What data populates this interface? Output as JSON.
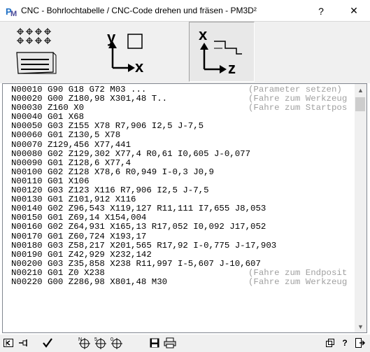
{
  "window": {
    "title": "CNC - Bohrlochtabelle / CNC-Code drehen und fräsen   -   PM3D²",
    "help_label": "?",
    "close_label": "✕"
  },
  "toolbar": {
    "xy_axis_x": "x",
    "xy_axis_y": "y",
    "xz_axis_x": "x",
    "xz_axis_z": "z"
  },
  "code_lines": [
    {
      "cmd": "N00010 G90 G18 G72 M03 ...",
      "comment": "(Parameter setzen)"
    },
    {
      "cmd": "N00020 G00 Z180,98 X301,48 T..",
      "comment": "(Fahre zum Werkzeug"
    },
    {
      "cmd": "N00030 Z160 X0",
      "comment": "(Fahre zum Startpos"
    },
    {
      "cmd": "N00040 G01 X68",
      "comment": ""
    },
    {
      "cmd": "N00050 G03 Z155 X78 R7,906 I2,5 J-7,5",
      "comment": ""
    },
    {
      "cmd": "N00060 G01 Z130,5 X78",
      "comment": ""
    },
    {
      "cmd": "N00070 Z129,456 X77,441",
      "comment": ""
    },
    {
      "cmd": "N00080 G02 Z129,302 X77,4 R0,61 I0,605 J-0,077",
      "comment": ""
    },
    {
      "cmd": "N00090 G01 Z128,6 X77,4",
      "comment": ""
    },
    {
      "cmd": "N00100 G02 Z128 X78,6 R0,949 I-0,3 J0,9",
      "comment": ""
    },
    {
      "cmd": "N00110 G01 X106",
      "comment": ""
    },
    {
      "cmd": "N00120 G03 Z123 X116 R7,906 I2,5 J-7,5",
      "comment": ""
    },
    {
      "cmd": "N00130 G01 Z101,912 X116",
      "comment": ""
    },
    {
      "cmd": "N00140 G02 Z96,543 X119,127 R11,111 I7,655 J8,053",
      "comment": ""
    },
    {
      "cmd": "N00150 G01 Z69,14 X154,004",
      "comment": ""
    },
    {
      "cmd": "N00160 G02 Z64,931 X165,13 R17,052 I0,092 J17,052",
      "comment": ""
    },
    {
      "cmd": "N00170 G01 Z60,724 X193,17",
      "comment": ""
    },
    {
      "cmd": "N00180 G03 Z58,217 X201,565 R17,92 I-0,775 J-17,903",
      "comment": ""
    },
    {
      "cmd": "N00190 G01 Z42,929 X232,142",
      "comment": ""
    },
    {
      "cmd": "N00200 G03 Z35,858 X238 R11,997 I-5,607 J-10,607",
      "comment": ""
    },
    {
      "cmd": "N00210 G01 Z0 X238",
      "comment": "(Fahre zum Endposit"
    },
    {
      "cmd": "N00220 G00 Z286,98 X801,48 M30",
      "comment": "(Fahre zum Werkzeug"
    }
  ],
  "bottom": {
    "crosshair1_label": "N",
    "crosshair2_label": "5",
    "crosshair3_label": "0"
  },
  "colors": {
    "comment": "#a0a0a0",
    "toolbar_bg": "#f0f0f0",
    "icon_blue": "#1e6fc4"
  }
}
